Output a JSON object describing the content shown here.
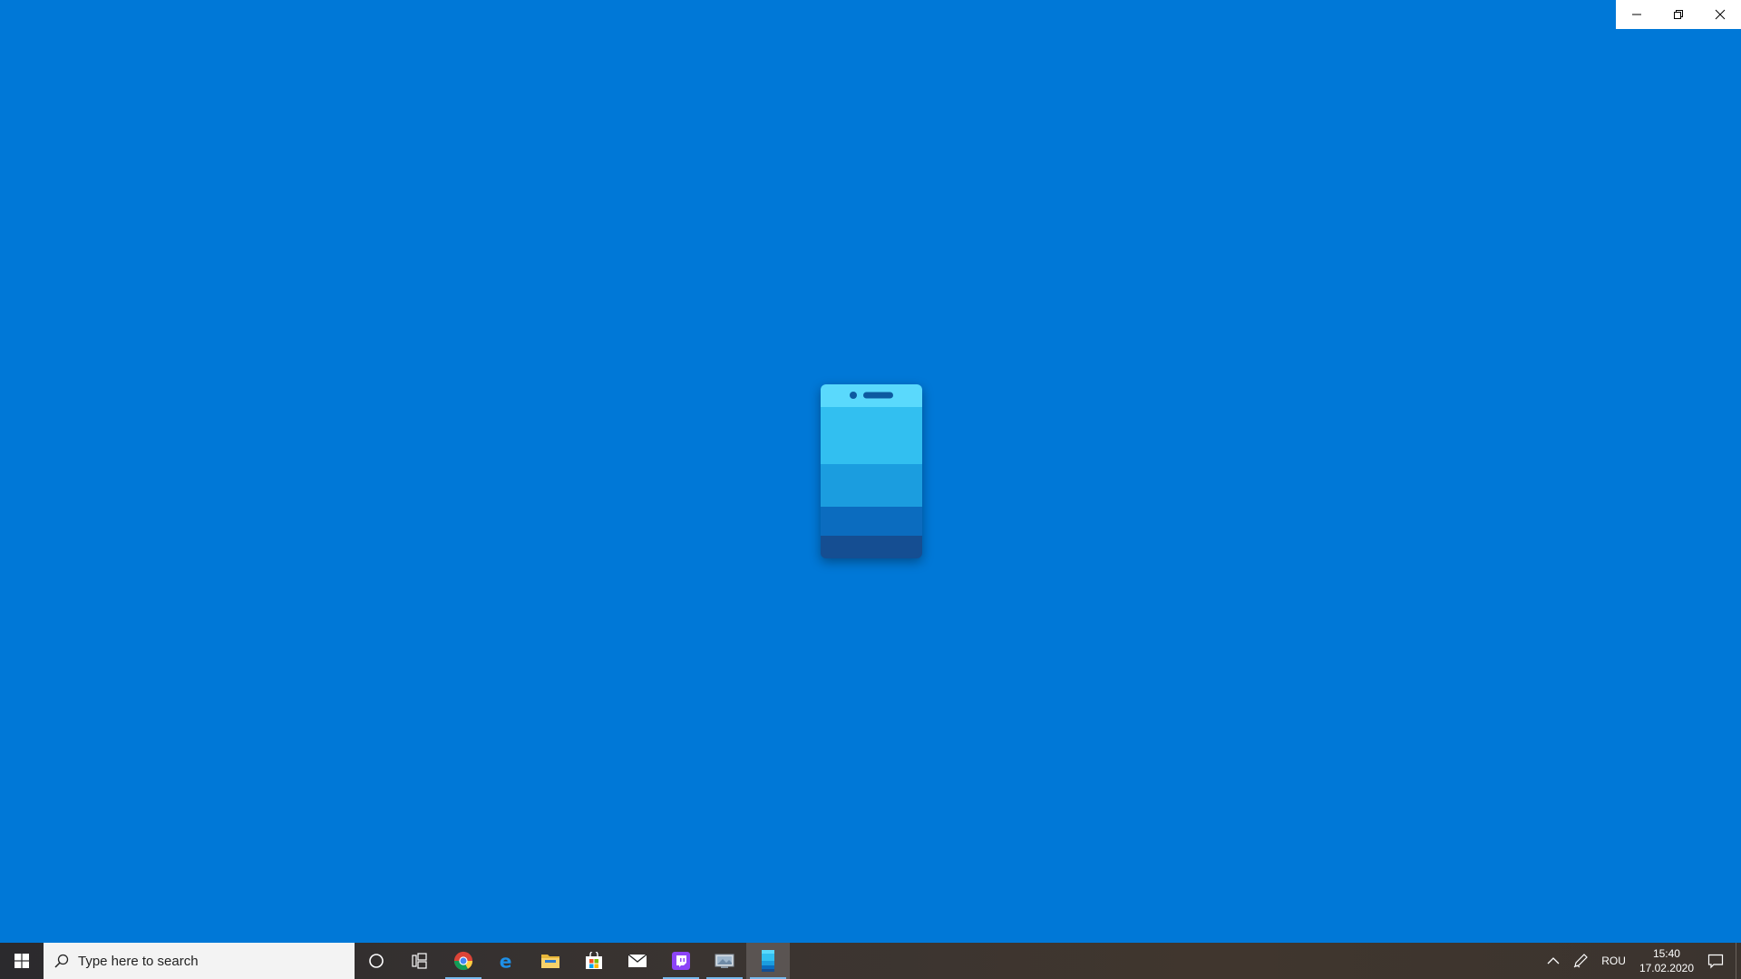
{
  "window": {
    "background_color": "#0078d7",
    "caption_buttons": [
      {
        "name": "minimize",
        "icon": "minimize-icon"
      },
      {
        "name": "restore",
        "icon": "restore-icon"
      },
      {
        "name": "close",
        "icon": "close-icon"
      }
    ]
  },
  "splash": {
    "icon": "phone-icon",
    "colors": [
      "#5ad9fc",
      "#32bff0",
      "#1b9ddf",
      "#0b6cbf",
      "#154e92"
    ]
  },
  "taskbar": {
    "search": {
      "placeholder": "Type here to search",
      "icon": "search-icon"
    },
    "pinned": [
      {
        "name": "cortana",
        "icon": "circle-icon"
      },
      {
        "name": "task-view",
        "icon": "task-view-icon"
      },
      {
        "name": "chrome",
        "icon": "chrome-icon",
        "running": true
      },
      {
        "name": "edge",
        "icon": "edge-icon"
      },
      {
        "name": "file-explorer",
        "icon": "folder-icon"
      },
      {
        "name": "store",
        "icon": "store-icon"
      },
      {
        "name": "mail",
        "icon": "mail-icon"
      },
      {
        "name": "twitch",
        "icon": "twitch-icon",
        "running": true
      },
      {
        "name": "app",
        "icon": "app-icon",
        "running": true
      },
      {
        "name": "your-phone",
        "icon": "phone-icon",
        "running": true,
        "active": true
      }
    ],
    "tray": {
      "chevron_icon": "chevron-up-icon",
      "pen_icon": "pen-icon",
      "language": "ROU",
      "time": "15:40",
      "date": "17.02.2020",
      "notification_icon": "notification-icon"
    }
  }
}
